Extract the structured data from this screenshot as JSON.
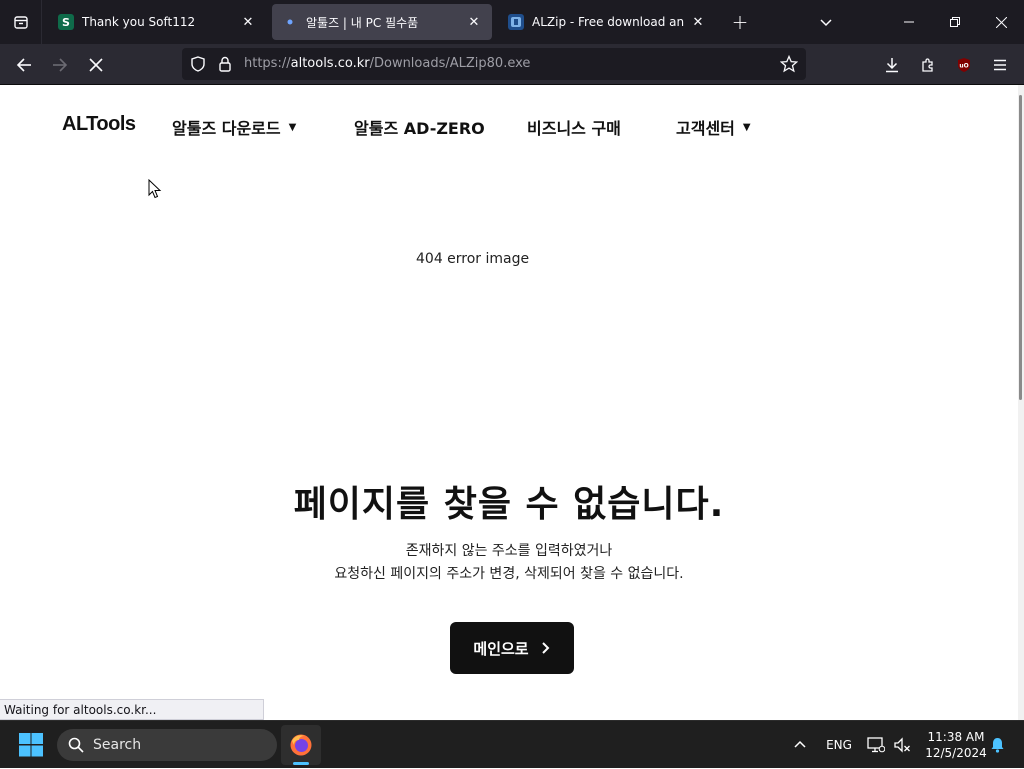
{
  "browser": {
    "tabs": [
      {
        "title": "Thank you Soft112",
        "favicon_letter": "S",
        "favicon_color": "#0f6b4a"
      },
      {
        "title": "알툴즈 | 내 PC 필수품",
        "favicon_color": "#42414d"
      },
      {
        "title": "ALZip - Free download and inst",
        "favicon_color": "#1f4e8c"
      }
    ],
    "url": {
      "prefix": "https://",
      "domain": "altools.co.kr",
      "path": "/Downloads/ALZip80.exe"
    }
  },
  "page": {
    "logo": "ALTools",
    "menu": [
      {
        "label": "알툴즈 다운로드",
        "has_dropdown": true
      },
      {
        "label": "알툴즈 AD-ZERO",
        "has_dropdown": false
      },
      {
        "label": "비즈니스 구매",
        "has_dropdown": false
      },
      {
        "label": "고객센터",
        "has_dropdown": true
      }
    ],
    "error_image_alt": "404 error image",
    "error_title": "페이지를 찾을 수 없습니다.",
    "error_desc_line1": "존재하지 않는 주소를 입력하였거나",
    "error_desc_line2": "요청하신 페이지의 주소가 변경, 삭제되어 찾을 수 없습니다.",
    "main_button": "메인으로",
    "status_text": "Waiting for altools.co.kr..."
  },
  "taskbar": {
    "search_placeholder": "Search",
    "language": "ENG",
    "time": "11:38 AM",
    "date": "12/5/2024"
  },
  "colors": {
    "tab_bar": "#1c1b22",
    "toolbar": "#2b2a33",
    "page_bg": "#ffffff",
    "button_bg": "#111111",
    "taskbar": "#1f1f1f",
    "accent": "#4cc2ff"
  }
}
